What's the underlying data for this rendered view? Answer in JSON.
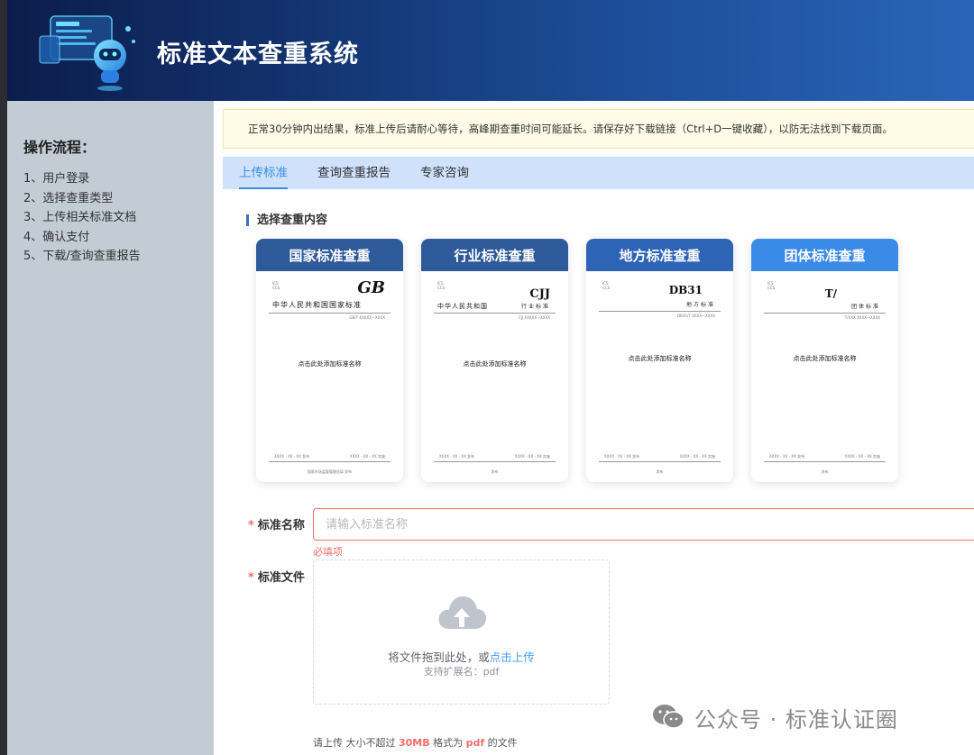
{
  "app": {
    "title": "标准文本查重系统"
  },
  "sidebar": {
    "title": "操作流程：",
    "steps": [
      "1、用户登录",
      "2、选择查重类型",
      "3、上传相关标准文档",
      "4、确认支付",
      "5、下载/查询查重报告"
    ]
  },
  "notice": "正常30分钟内出结果，标准上传后请耐心等待，高峰期查重时间可能延长。请保存好下载链接（Ctrl+D一键收藏），以防无法找到下载页面。",
  "tabs": [
    {
      "label": "上传标准",
      "active": true
    },
    {
      "label": "查询查重报告",
      "active": false
    },
    {
      "label": "专家咨询",
      "active": false
    }
  ],
  "section_title": "选择查重内容",
  "cards": [
    {
      "title": "国家标准查重",
      "header_color": "#2f5a9a",
      "doc": {
        "code": "GB",
        "org_line": "中华人民共和国国家标准",
        "sub_line": "",
        "number": "GB/T XXXXX—XXXX",
        "name": "点击此处添加标准名称",
        "date_left": "XXXX - XX - XX 发布",
        "date_right": "XXXX - XX - XX 实施",
        "footer": "国家市场监督管理总局 发布"
      }
    },
    {
      "title": "行业标准查重",
      "header_color": "#2f5a9a",
      "doc": {
        "code": "CJJ",
        "org_line": "中华人民共和国",
        "sub_line": "行业标准",
        "number": "CJJ XXXXX—XXXX",
        "name": "点击此处添加标准名称",
        "date_left": "XXXX - XX - XX 发布",
        "date_right": "XXXX - XX - XX 实施",
        "footer": "发布"
      }
    },
    {
      "title": "地方标准查重",
      "header_color": "#2d64b5",
      "doc": {
        "code": "DB31",
        "org_line": "",
        "sub_line": "地方标准",
        "number": "DB31/T XXXX—XXXX",
        "name": "点击此处添加标准名称",
        "date_left": "XXXX - XX - XX 发布",
        "date_right": "XXXX - XX - XX 实施",
        "footer": "发布"
      }
    },
    {
      "title": "团体标准查重",
      "header_color": "#3a8ae8",
      "doc": {
        "code": "T/",
        "org_line": "",
        "sub_line": "团体标准",
        "number": "T/XXX XXXX—XXXX",
        "name": "点击此处添加标准名称",
        "date_left": "XXXX - XX - XX 发布",
        "date_right": "XXXX - XX - XX 实施",
        "footer": "发布"
      }
    }
  ],
  "form": {
    "name_label": "标准名称",
    "name_placeholder": "请输入标准名称",
    "name_error": "必填项",
    "file_label": "标准文件",
    "drag_text": "将文件拖到此处，或",
    "click_upload": "点击上传",
    "ext_hint": "支持扩展名：pdf",
    "tip_prefix": "请上传 大小不超过 ",
    "tip_size": "30MB",
    "tip_mid": " 格式为 ",
    "tip_format": "pdf",
    "tip_suffix": " 的文件"
  },
  "watermark": "公众号 · 标准认证圈",
  "colors": {
    "accent": "#3a8ee6",
    "error": "#f56c6c",
    "link": "#409eff",
    "sidebar_bg": "#c3ccd4",
    "tabs_bg": "#cfe1fb",
    "notice_bg": "#fffbe6"
  }
}
